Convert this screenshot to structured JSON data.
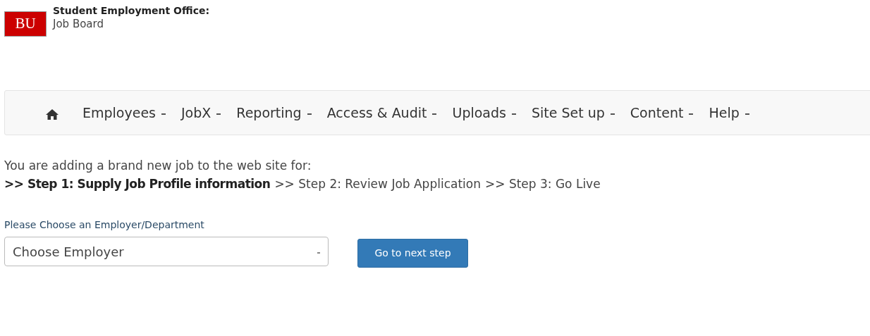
{
  "header": {
    "logo": "BU",
    "title": "Student Employment Office:",
    "subtitle": "Job Board"
  },
  "nav": {
    "items": [
      {
        "label": "Employees"
      },
      {
        "label": "JobX"
      },
      {
        "label": "Reporting"
      },
      {
        "label": "Access & Audit"
      },
      {
        "label": "Uploads"
      },
      {
        "label": "Site Set up"
      },
      {
        "label": "Content"
      },
      {
        "label": "Help"
      }
    ]
  },
  "intro": "You are adding a brand new job to the web site for:",
  "steps": [
    {
      "label": ">> Step 1: Supply Job Profile information",
      "selected": true
    },
    {
      "label": ">> Step 2: Review Job Application",
      "selected": false
    },
    {
      "label": ">> Step 3: Go Live",
      "selected": false
    }
  ],
  "employer": {
    "label": "Please Choose an Employer/Department",
    "value": "Choose Employer"
  },
  "button": "Go to next step"
}
